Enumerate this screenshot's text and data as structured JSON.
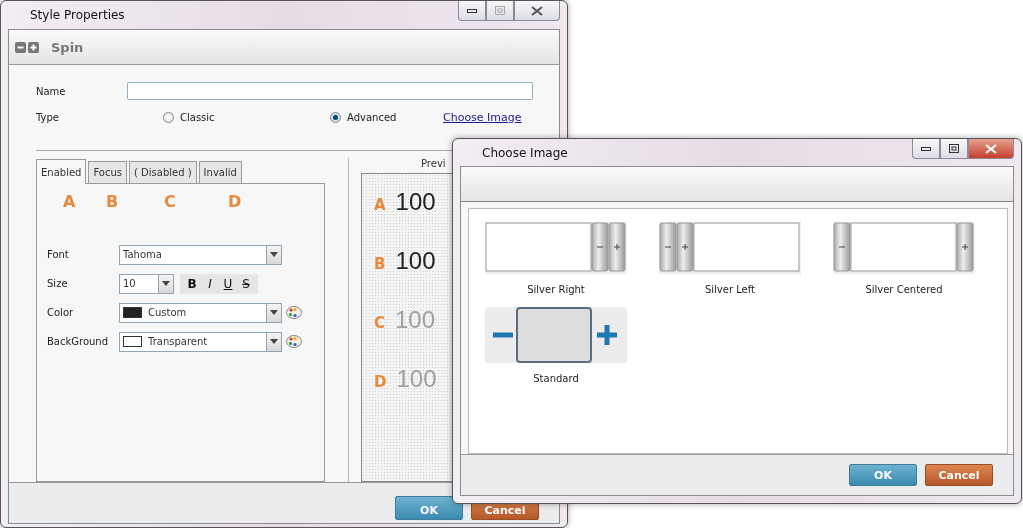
{
  "main_window": {
    "title": "Style Properties",
    "section": {
      "title": "Spin"
    },
    "name_label": "Name",
    "type_label": "Type",
    "type_options": [
      {
        "label": "Classic",
        "selected": false
      },
      {
        "label": "Advanced",
        "selected": true
      }
    ],
    "choose_image_link": "Choose Image",
    "tabs": [
      {
        "label": "Enabled",
        "selected": true
      },
      {
        "label": "Focus",
        "selected": false
      },
      {
        "label": "( Disabled )",
        "selected": false
      },
      {
        "label": "Invalid",
        "selected": false
      }
    ],
    "tab_markers": [
      "A",
      "B",
      "C",
      "D"
    ],
    "font": {
      "label": "Font",
      "value": "Tahoma"
    },
    "size": {
      "label": "Size",
      "value": "10",
      "styles": [
        "B",
        "I",
        "U",
        "S"
      ]
    },
    "color": {
      "label": "Color",
      "value": "Custom"
    },
    "background": {
      "label": "BackGround",
      "value": "Transparent"
    },
    "preview": {
      "title": "Previ",
      "rows": [
        {
          "marker": "A",
          "value": "100",
          "color": "#222222"
        },
        {
          "marker": "B",
          "value": "100",
          "color": "#222222"
        },
        {
          "marker": "C",
          "value": "100",
          "color": "#a0a0a0"
        },
        {
          "marker": "D",
          "value": "100",
          "color": "#a0a0a0"
        }
      ]
    },
    "buttons": [
      {
        "label": "OK",
        "kind": "ok"
      },
      {
        "label": "Cancel",
        "kind": "cancel"
      }
    ]
  },
  "dialog": {
    "title": "Choose Image",
    "images": [
      {
        "label": "Silver Right",
        "kind": "right"
      },
      {
        "label": "Silver Left",
        "kind": "left"
      },
      {
        "label": "Silver Centered",
        "kind": "centered"
      },
      {
        "label": "Standard",
        "kind": "standard"
      }
    ],
    "buttons": [
      {
        "label": "OK",
        "kind": "ok"
      },
      {
        "label": "Cancel",
        "kind": "cancel"
      }
    ]
  }
}
